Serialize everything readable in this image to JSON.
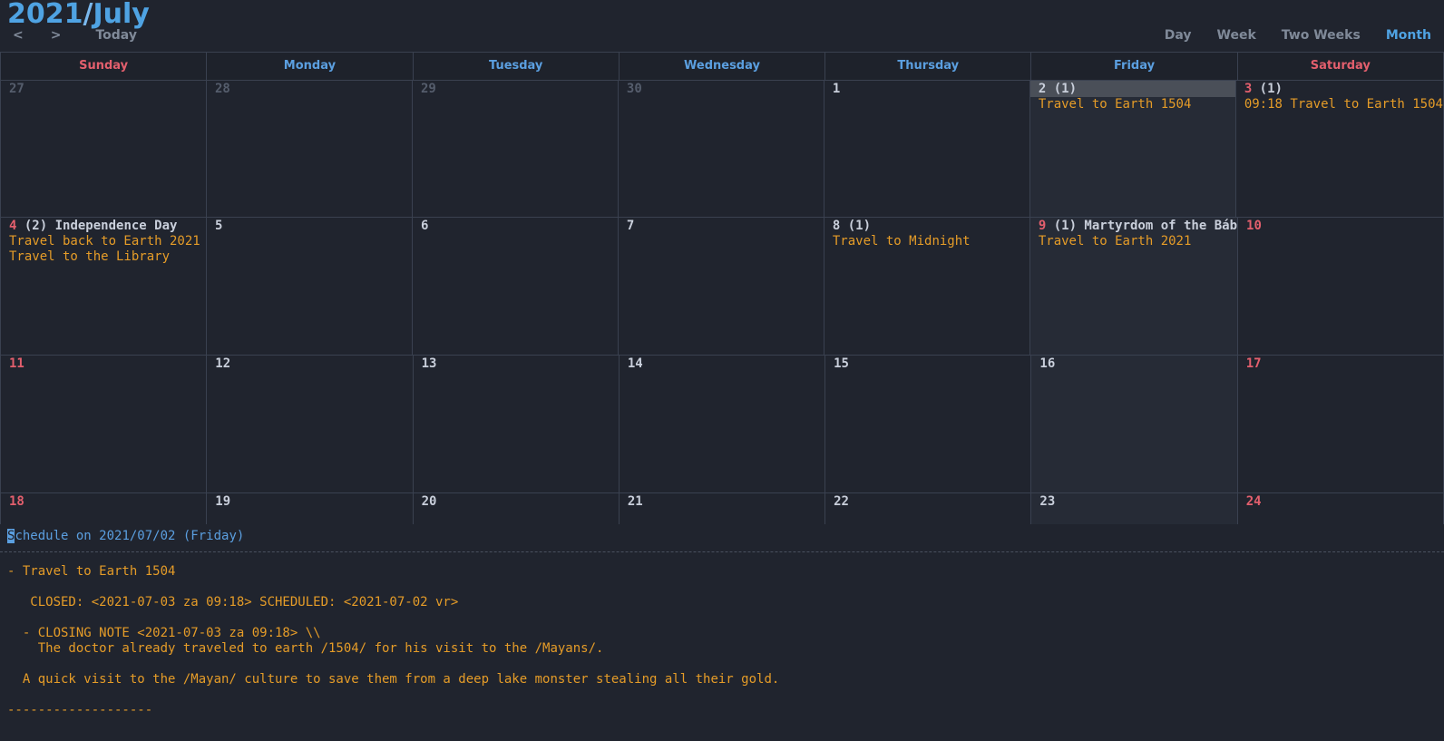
{
  "header": {
    "year": "2021",
    "separator": "/",
    "month": "July",
    "prev_label": "<",
    "next_label": ">",
    "today_label": "Today",
    "views": [
      {
        "label": "Day",
        "active": false
      },
      {
        "label": "Week",
        "active": false
      },
      {
        "label": "Two Weeks",
        "active": false
      },
      {
        "label": "Month",
        "active": true
      }
    ],
    "accent_color": "#4fa3e3",
    "muted_color": "#808a99"
  },
  "weekdays": [
    {
      "label": "Sunday",
      "weekend": true
    },
    {
      "label": "Monday",
      "weekend": false
    },
    {
      "label": "Tuesday",
      "weekend": false
    },
    {
      "label": "Wednesday",
      "weekend": false
    },
    {
      "label": "Thursday",
      "weekend": false
    },
    {
      "label": "Friday",
      "weekend": false
    },
    {
      "label": "Saturday",
      "weekend": true
    }
  ],
  "weeks": [
    {
      "days": [
        {
          "num": "27",
          "dim": true,
          "red": false,
          "count": "",
          "holiday": "",
          "selected": false,
          "highlight": false,
          "events": []
        },
        {
          "num": "28",
          "dim": true,
          "red": false,
          "count": "",
          "holiday": "",
          "selected": false,
          "highlight": false,
          "events": []
        },
        {
          "num": "29",
          "dim": true,
          "red": false,
          "count": "",
          "holiday": "",
          "selected": false,
          "highlight": false,
          "events": []
        },
        {
          "num": "30",
          "dim": true,
          "red": false,
          "count": "",
          "holiday": "",
          "selected": false,
          "highlight": false,
          "events": []
        },
        {
          "num": "1",
          "dim": false,
          "red": false,
          "count": "",
          "holiday": "",
          "selected": false,
          "highlight": false,
          "events": []
        },
        {
          "num": "2",
          "dim": false,
          "red": false,
          "count": "(1)",
          "holiday": "",
          "selected": true,
          "highlight": true,
          "events": [
            "Travel to Earth 1504"
          ]
        },
        {
          "num": "3",
          "dim": false,
          "red": true,
          "count": "(1)",
          "holiday": "",
          "selected": false,
          "highlight": false,
          "events": [
            "09:18 Travel to Earth 1504"
          ]
        }
      ]
    },
    {
      "days": [
        {
          "num": "4",
          "dim": false,
          "red": true,
          "count": "(2)",
          "holiday": "Independence Day",
          "selected": false,
          "highlight": false,
          "events": [
            "Travel back to Earth 2021",
            "Travel to the Library"
          ]
        },
        {
          "num": "5",
          "dim": false,
          "red": false,
          "count": "",
          "holiday": "",
          "selected": false,
          "highlight": false,
          "events": []
        },
        {
          "num": "6",
          "dim": false,
          "red": false,
          "count": "",
          "holiday": "",
          "selected": false,
          "highlight": false,
          "events": []
        },
        {
          "num": "7",
          "dim": false,
          "red": false,
          "count": "",
          "holiday": "",
          "selected": false,
          "highlight": false,
          "events": []
        },
        {
          "num": "8",
          "dim": false,
          "red": false,
          "count": "(1)",
          "holiday": "",
          "selected": false,
          "highlight": false,
          "events": [
            "Travel to Midnight"
          ]
        },
        {
          "num": "9",
          "dim": false,
          "red": true,
          "count": "(1)",
          "holiday": "Martyrdom of the Báb",
          "selected": true,
          "highlight": false,
          "events": [
            "Travel to Earth 2021"
          ]
        },
        {
          "num": "10",
          "dim": false,
          "red": true,
          "count": "",
          "holiday": "",
          "selected": false,
          "highlight": false,
          "events": []
        }
      ]
    },
    {
      "days": [
        {
          "num": "11",
          "dim": false,
          "red": true,
          "count": "",
          "holiday": "",
          "selected": false,
          "highlight": false,
          "events": []
        },
        {
          "num": "12",
          "dim": false,
          "red": false,
          "count": "",
          "holiday": "",
          "selected": false,
          "highlight": false,
          "events": []
        },
        {
          "num": "13",
          "dim": false,
          "red": false,
          "count": "",
          "holiday": "",
          "selected": false,
          "highlight": false,
          "events": []
        },
        {
          "num": "14",
          "dim": false,
          "red": false,
          "count": "",
          "holiday": "",
          "selected": false,
          "highlight": false,
          "events": []
        },
        {
          "num": "15",
          "dim": false,
          "red": false,
          "count": "",
          "holiday": "",
          "selected": false,
          "highlight": false,
          "events": []
        },
        {
          "num": "16",
          "dim": false,
          "red": false,
          "count": "",
          "holiday": "",
          "selected": true,
          "highlight": false,
          "events": []
        },
        {
          "num": "17",
          "dim": false,
          "red": true,
          "count": "",
          "holiday": "",
          "selected": false,
          "highlight": false,
          "events": []
        }
      ]
    },
    {
      "days": [
        {
          "num": "18",
          "dim": false,
          "red": true,
          "count": "",
          "holiday": "",
          "selected": false,
          "highlight": false,
          "events": []
        },
        {
          "num": "19",
          "dim": false,
          "red": false,
          "count": "",
          "holiday": "",
          "selected": false,
          "highlight": false,
          "events": []
        },
        {
          "num": "20",
          "dim": false,
          "red": false,
          "count": "",
          "holiday": "",
          "selected": false,
          "highlight": false,
          "events": []
        },
        {
          "num": "21",
          "dim": false,
          "red": false,
          "count": "",
          "holiday": "",
          "selected": false,
          "highlight": false,
          "events": []
        },
        {
          "num": "22",
          "dim": false,
          "red": false,
          "count": "",
          "holiday": "",
          "selected": false,
          "highlight": false,
          "events": []
        },
        {
          "num": "23",
          "dim": false,
          "red": false,
          "count": "",
          "holiday": "",
          "selected": true,
          "highlight": false,
          "events": []
        },
        {
          "num": "24",
          "dim": false,
          "red": true,
          "count": "",
          "holiday": "",
          "selected": false,
          "highlight": false,
          "events": []
        }
      ]
    }
  ],
  "schedule": {
    "cursor_char": "S",
    "title_rest": "chedule on 2021/07/02 (Friday)",
    "lines": [
      "- Travel to Earth 1504",
      "",
      "   CLOSED: <2021-07-03 za 09:18> SCHEDULED: <2021-07-02 vr>",
      "",
      "  - CLOSING NOTE <2021-07-03 za 09:18> \\\\",
      "    The doctor already traveled to earth /1504/ for his visit to the /Mayans/.",
      "",
      "  A quick visit to the /Mayan/ culture to save them from a deep lake monster stealing all their gold.",
      "",
      "-------------------"
    ],
    "text_color": "#e59c28",
    "title_color": "#5b9fe0"
  }
}
